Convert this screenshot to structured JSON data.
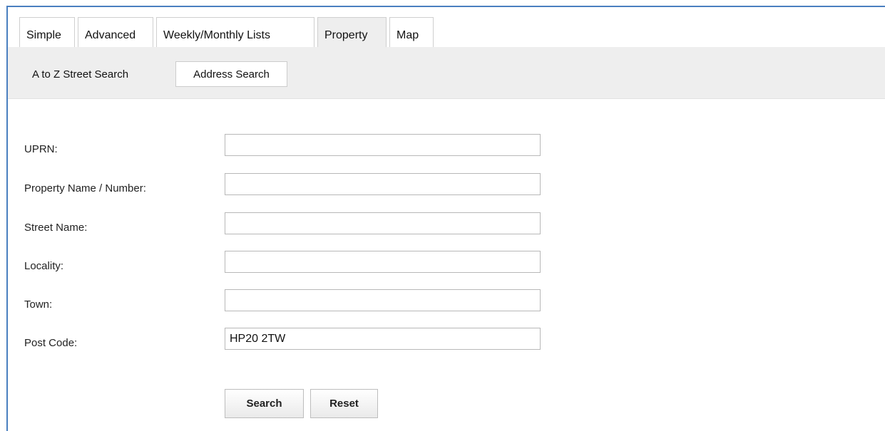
{
  "tabs": [
    {
      "label": "Simple"
    },
    {
      "label": "Advanced"
    },
    {
      "label": "Weekly/Monthly Lists"
    },
    {
      "label": "Property"
    },
    {
      "label": "Map"
    }
  ],
  "subnav": {
    "items": [
      {
        "label": "A to Z Street Search"
      },
      {
        "label": "Address Search"
      }
    ]
  },
  "form": {
    "uprn": {
      "label": "UPRN:",
      "value": ""
    },
    "property": {
      "label": "Property Name / Number:",
      "value": ""
    },
    "street": {
      "label": "Street Name:",
      "value": ""
    },
    "locality": {
      "label": "Locality:",
      "value": ""
    },
    "town": {
      "label": "Town:",
      "value": ""
    },
    "postcode": {
      "label": "Post Code:",
      "value": "HP20 2TW"
    }
  },
  "buttons": {
    "search_label": "Search",
    "reset_label": "Reset"
  },
  "colors": {
    "frame_border": "#4a7fc0",
    "nav_background": "#eeeeee"
  }
}
